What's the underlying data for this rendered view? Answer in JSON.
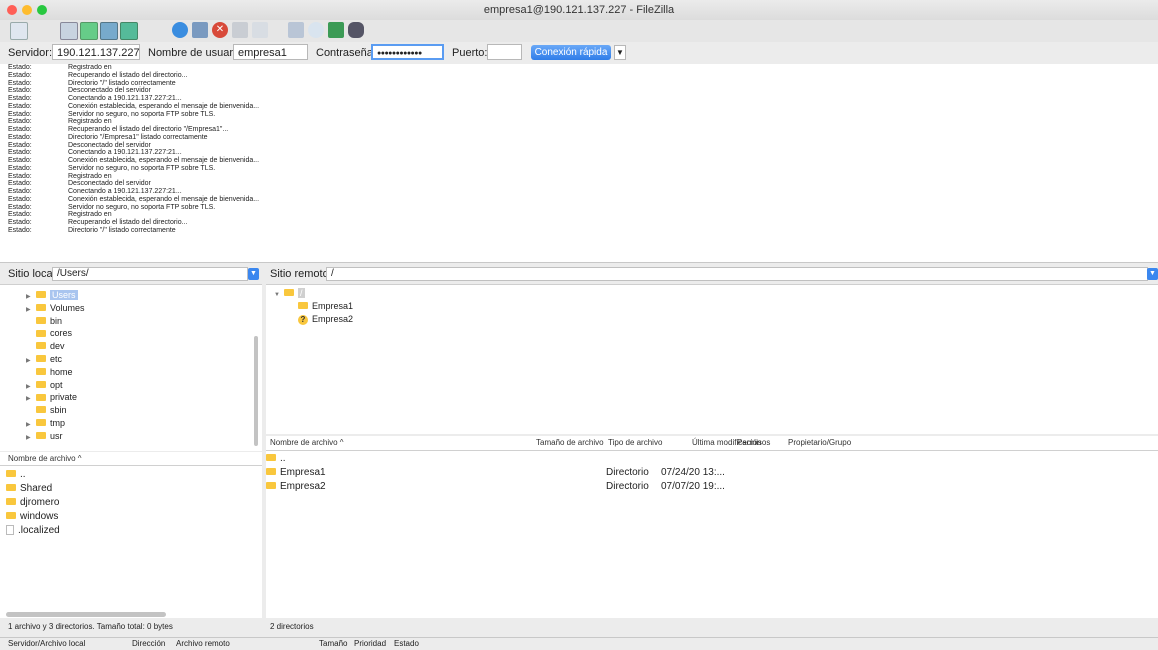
{
  "window": {
    "title": "empresa1@190.121.137.227 - FileZilla"
  },
  "colors": {
    "accent": "#3b87ef",
    "folder": "#f9c73d",
    "selection": "#a9c5ef"
  },
  "toolbar": {
    "icons": [
      "site-manager-icon",
      "message-log-icon",
      "local-tree-icon",
      "remote-tree-icon",
      "refresh-icon",
      "process-queue-icon",
      "cancel-icon",
      "disconnect-icon",
      "reconnect-icon",
      "filter-icon",
      "compare-icon",
      "sync-browse-icon",
      "search-icon"
    ]
  },
  "quickconnect": {
    "server_label": "Servidor:",
    "server_value": "190.121.137.227",
    "user_label": "Nombre de usuario:",
    "user_value": "empresa1",
    "pass_label": "Contraseña:",
    "pass_value": "●●●●●●●●●●●●",
    "port_label": "Puerto:",
    "port_value": "",
    "button": "Conexión rápida",
    "dropdown": "▼"
  },
  "log": [
    {
      "k": "Estado:",
      "m": "Registrado en"
    },
    {
      "k": "Estado:",
      "m": "Recuperando el listado del directorio..."
    },
    {
      "k": "Estado:",
      "m": "Directorio \"/\" listado correctamente"
    },
    {
      "k": "Estado:",
      "m": "Desconectado del servidor"
    },
    {
      "k": "Estado:",
      "m": "Conectando a 190.121.137.227:21..."
    },
    {
      "k": "Estado:",
      "m": "Conexión establecida, esperando el mensaje de bienvenida..."
    },
    {
      "k": "Estado:",
      "m": "Servidor no seguro, no soporta FTP sobre TLS."
    },
    {
      "k": "Estado:",
      "m": "Registrado en"
    },
    {
      "k": "Estado:",
      "m": "Recuperando el listado del directorio \"/Empresa1\"..."
    },
    {
      "k": "Estado:",
      "m": "Directorio \"/Empresa1\" listado correctamente"
    },
    {
      "k": "Estado:",
      "m": "Desconectado del servidor"
    },
    {
      "k": "Estado:",
      "m": "Conectando a 190.121.137.227:21..."
    },
    {
      "k": "Estado:",
      "m": "Conexión establecida, esperando el mensaje de bienvenida..."
    },
    {
      "k": "Estado:",
      "m": "Servidor no seguro, no soporta FTP sobre TLS."
    },
    {
      "k": "Estado:",
      "m": "Registrado en"
    },
    {
      "k": "Estado:",
      "m": "Desconectado del servidor"
    },
    {
      "k": "Estado:",
      "m": "Conectando a 190.121.137.227:21..."
    },
    {
      "k": "Estado:",
      "m": "Conexión establecida, esperando el mensaje de bienvenida..."
    },
    {
      "k": "Estado:",
      "m": "Servidor no seguro, no soporta FTP sobre TLS."
    },
    {
      "k": "Estado:",
      "m": "Registrado en"
    },
    {
      "k": "Estado:",
      "m": "Recuperando el listado del directorio..."
    },
    {
      "k": "Estado:",
      "m": "Directorio \"/\" listado correctamente"
    }
  ],
  "local": {
    "site_label": "Sitio local:",
    "site_value": "/Users/",
    "tree": [
      {
        "name": "Users",
        "expand": true,
        "selected": true
      },
      {
        "name": "Volumes",
        "expand": true
      },
      {
        "name": "bin",
        "expand": false
      },
      {
        "name": "cores",
        "expand": false
      },
      {
        "name": "dev",
        "expand": false
      },
      {
        "name": "etc",
        "expand": true
      },
      {
        "name": "home",
        "expand": false
      },
      {
        "name": "opt",
        "expand": true
      },
      {
        "name": "private",
        "expand": true
      },
      {
        "name": "sbin",
        "expand": false
      },
      {
        "name": "tmp",
        "expand": true
      },
      {
        "name": "usr",
        "expand": true
      }
    ],
    "col_name": "Nombre de archivo ^",
    "files": [
      {
        "name": "..",
        "type": "folder"
      },
      {
        "name": "Shared",
        "type": "folder"
      },
      {
        "name": "djromero",
        "type": "folder"
      },
      {
        "name": "windows",
        "type": "folder"
      },
      {
        "name": ".localized",
        "type": "file"
      }
    ],
    "status": "1 archivo y 3 directorios. Tamaño total: 0 bytes"
  },
  "remote": {
    "site_label": "Sitio remoto:",
    "site_value": "/",
    "tree": [
      {
        "name": "/",
        "level": 0
      },
      {
        "name": "Empresa1",
        "level": 1,
        "icon": "folder"
      },
      {
        "name": "Empresa2",
        "level": 1,
        "icon": "unknown"
      }
    ],
    "cols": {
      "name": "Nombre de archivo ^",
      "size": "Tamaño de archivo",
      "type": "Tipo de archivo",
      "modified": "Última modificación",
      "perms": "Permisos",
      "owner": "Propietario/Grupo"
    },
    "files": [
      {
        "name": "..",
        "type": "",
        "modified": ""
      },
      {
        "name": "Empresa1",
        "type": "Directorio",
        "modified": "07/24/20 13:..."
      },
      {
        "name": "Empresa2",
        "type": "Directorio",
        "modified": "07/07/20 19:..."
      }
    ],
    "status": "2 directorios"
  },
  "queue": {
    "cols": [
      "Servidor/Archivo local",
      "Dirección",
      "Archivo remoto",
      "Tamaño",
      "Prioridad",
      "Estado"
    ]
  }
}
